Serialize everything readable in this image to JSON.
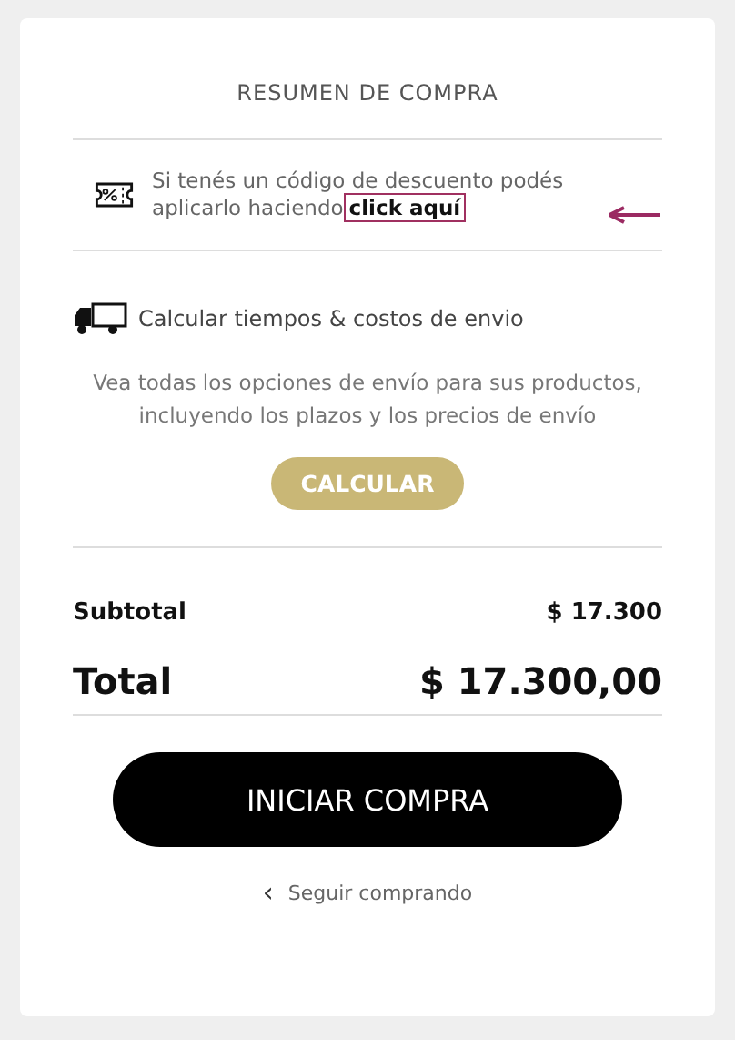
{
  "title": "RESUMEN DE COMPRA",
  "coupon": {
    "text": "Si tenés un código de descuento podés aplicarlo haciendo",
    "link": "click aquí"
  },
  "shipping": {
    "heading": "Calcular tiempos & costos de envio",
    "description": "Vea todas los opciones de envío para sus productos, incluyendo los plazos y los precios de envío",
    "button": "CALCULAR"
  },
  "summary": [
    {
      "kind": "subtotal",
      "label": "Subtotal",
      "value": "$ 17.300"
    },
    {
      "kind": "total",
      "label": "Total",
      "value": "$ 17.300,00"
    }
  ],
  "checkout_button": "INICIAR COMPRA",
  "back_link": {
    "icon": "‹",
    "label": "Seguir comprando"
  }
}
